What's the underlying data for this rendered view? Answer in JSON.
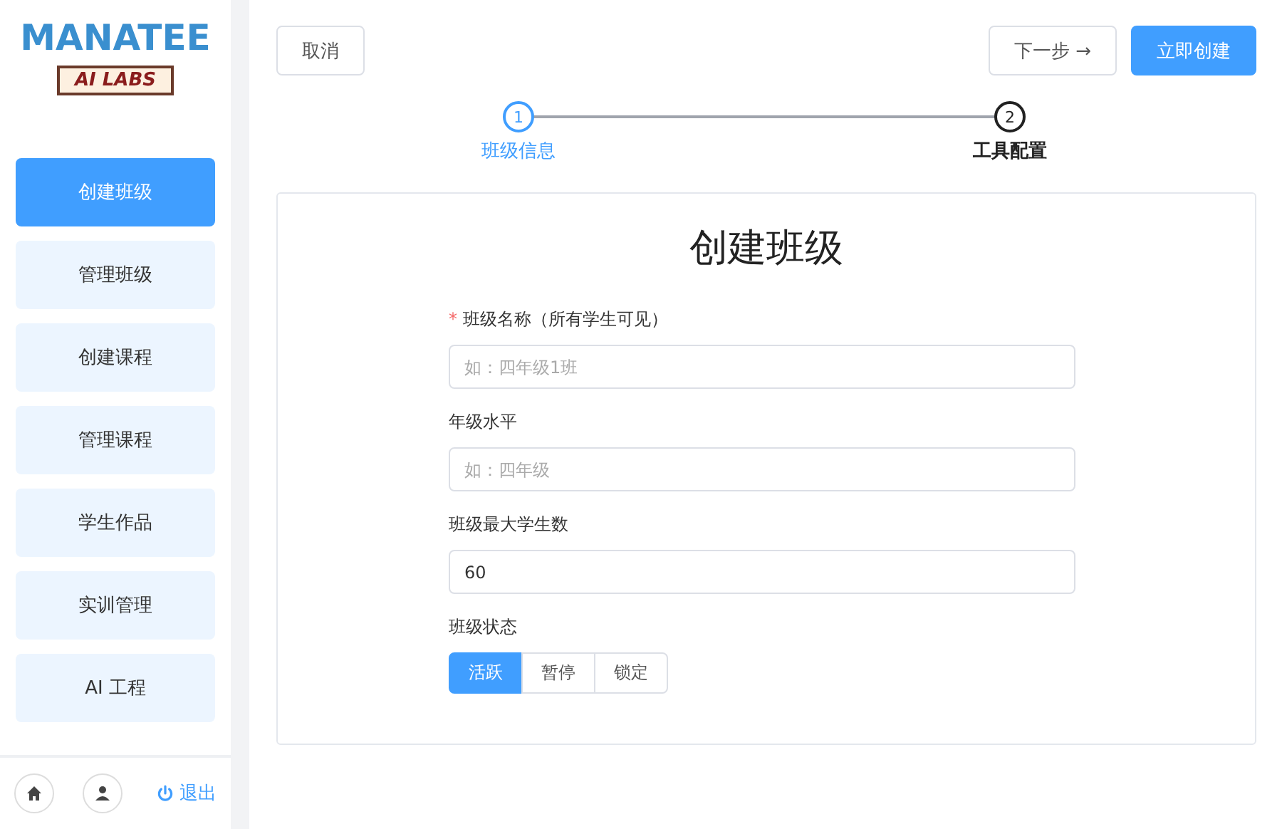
{
  "logo": {
    "title": "MANATEE",
    "subtitle": "AI LABS"
  },
  "sidebar": {
    "items": [
      {
        "label": "创建班级",
        "selected": true
      },
      {
        "label": "管理班级",
        "selected": false
      },
      {
        "label": "创建课程",
        "selected": false
      },
      {
        "label": "管理课程",
        "selected": false
      },
      {
        "label": "学生作品",
        "selected": false
      },
      {
        "label": "实训管理",
        "selected": false
      },
      {
        "label": "AI 工程",
        "selected": false
      }
    ],
    "logout": "退出"
  },
  "toolbar": {
    "cancel": "取消",
    "next": "下一步 →",
    "create": "立即创建"
  },
  "steps": [
    {
      "number": "1",
      "label": "班级信息",
      "selected": true
    },
    {
      "number": "2",
      "label": "工具配置",
      "selected": false
    }
  ],
  "form": {
    "title": "创建班级",
    "fields": [
      {
        "label": "班级名称（所有学生可见）",
        "marker": "*",
        "placeholder": "如：四年级1班"
      },
      {
        "label": "年级水平",
        "placeholder": "如：四年级"
      },
      {
        "label": "班级最大学生数",
        "value": "60"
      }
    ],
    "status": {
      "label": "班级状态",
      "options": [
        {
          "label": "活跃",
          "selected": true
        },
        {
          "label": "暂停",
          "selected": false
        },
        {
          "label": "锁定",
          "selected": false
        }
      ]
    }
  }
}
